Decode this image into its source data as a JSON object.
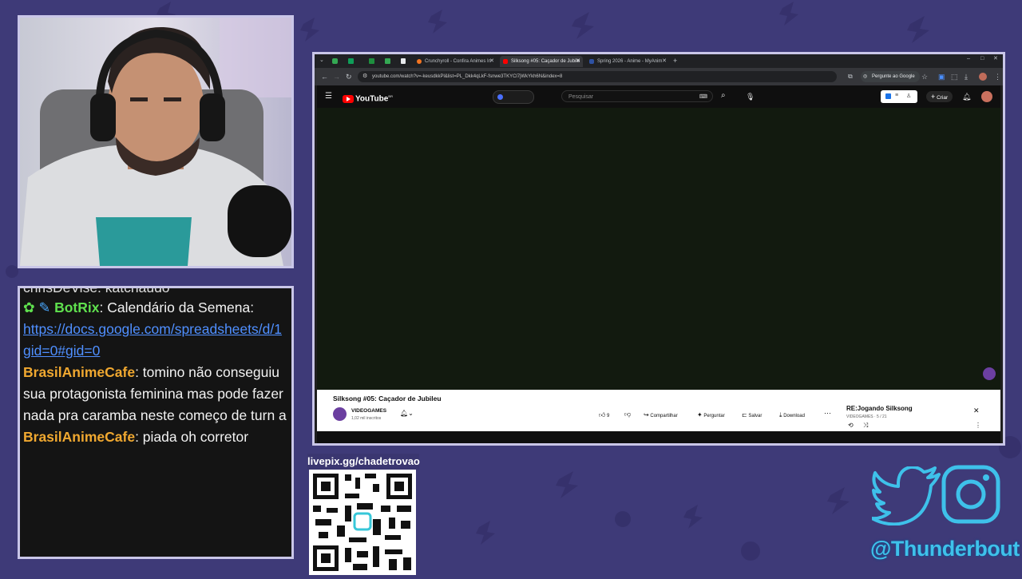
{
  "chat": {
    "cut_top": "chrisDeVise: katchaudo",
    "messages": [
      {
        "user": "BotRix",
        "text": ": Calendário da Semena:"
      },
      {
        "link": "https://docs.google.com/spreadsheets/d/1"
      },
      {
        "link": "gid=0#gid=0"
      },
      {
        "user": "BrasilAnimeCafe",
        "text": ": tomino não conseguiu"
      },
      {
        "text": "sua protagonista feminina mas pode fazer"
      },
      {
        "text": "nada pra caramba neste começo de turn a"
      },
      {
        "user": "BrasilAnimeCafe",
        "text": ": piada oh corretor"
      }
    ]
  },
  "qr": {
    "label": "livepix.gg/chadetrovao"
  },
  "social": {
    "handle": "@Thunderbout",
    "twitter_icon": "twitter-bird-icon",
    "instagram_icon": "instagram-icon"
  },
  "browser": {
    "tabs": [
      {
        "label": "Crunchyroll - Confira Animes In",
        "color": "#f47521"
      },
      {
        "label": "Silksong #05: Caçador de Jubile",
        "color": "#ff0000"
      },
      {
        "label": "Spring 2026 - Anime - MyAnim",
        "color": "#2e51a2"
      }
    ],
    "url": "youtube.com/watch?v=-keusdkkPl&list=PL_Dkk4qLkF-fsnwe3TKYCl7jWkYkh6N&index=8",
    "ask_google": "Pergunte ao Google"
  },
  "youtube": {
    "logo": "YouTube",
    "logo_sup": "BR",
    "search_placeholder": "Pesquisar",
    "create_label": "Criar",
    "video_title": "Silksong #05: Caçador de Jubileu",
    "channel": "VIDEOGAMES",
    "subscribers": "1,02 mil inscritos",
    "likes": "9",
    "share": "Compartilhar",
    "ask": "Perguntar",
    "save": "Salvar",
    "download": "Download",
    "playlist_title": "RE:Jogando Silksong",
    "playlist_sub": "VIDEOGAMES · 5 / 21"
  }
}
